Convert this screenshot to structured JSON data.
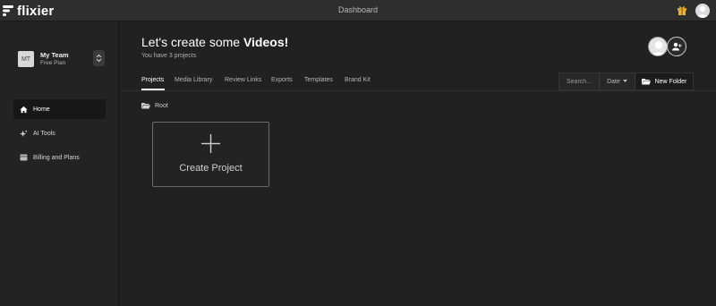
{
  "brand": {
    "name": "flixier"
  },
  "topbar": {
    "title": "Dashboard",
    "icons": [
      "gift-icon",
      "user-avatar"
    ]
  },
  "sidebar": {
    "team": {
      "initials": "MT",
      "name": "My Team",
      "plan": "Free Plan"
    },
    "items": [
      {
        "label": "Home",
        "icon": "home-icon",
        "active": true
      },
      {
        "label": "AI Tools",
        "icon": "sparkle-icon",
        "active": false
      },
      {
        "label": "Billing and Plans",
        "icon": "card-icon",
        "active": false
      }
    ]
  },
  "header": {
    "title_prefix": "Let's create some ",
    "title_emphasis": "Videos!",
    "subtitle": "You have 3 projects"
  },
  "tabs": [
    {
      "label": "Projects",
      "active": true
    },
    {
      "label": "Media Library",
      "active": false
    },
    {
      "label": "Review Links",
      "active": false
    },
    {
      "label": "Exports",
      "active": false
    },
    {
      "label": "Templates",
      "active": false
    },
    {
      "label": "Brand Kit",
      "active": false
    }
  ],
  "toolbar": {
    "search_placeholder": "Search...",
    "sort_label": "Date",
    "new_folder_label": "New Folder"
  },
  "breadcrumb": {
    "label": "Root"
  },
  "create_card": {
    "label": "Create Project"
  },
  "colors": {
    "background": "#212121",
    "sidebar": "#232323",
    "topbar": "#2e2e2e",
    "accent": "#ffffff"
  }
}
